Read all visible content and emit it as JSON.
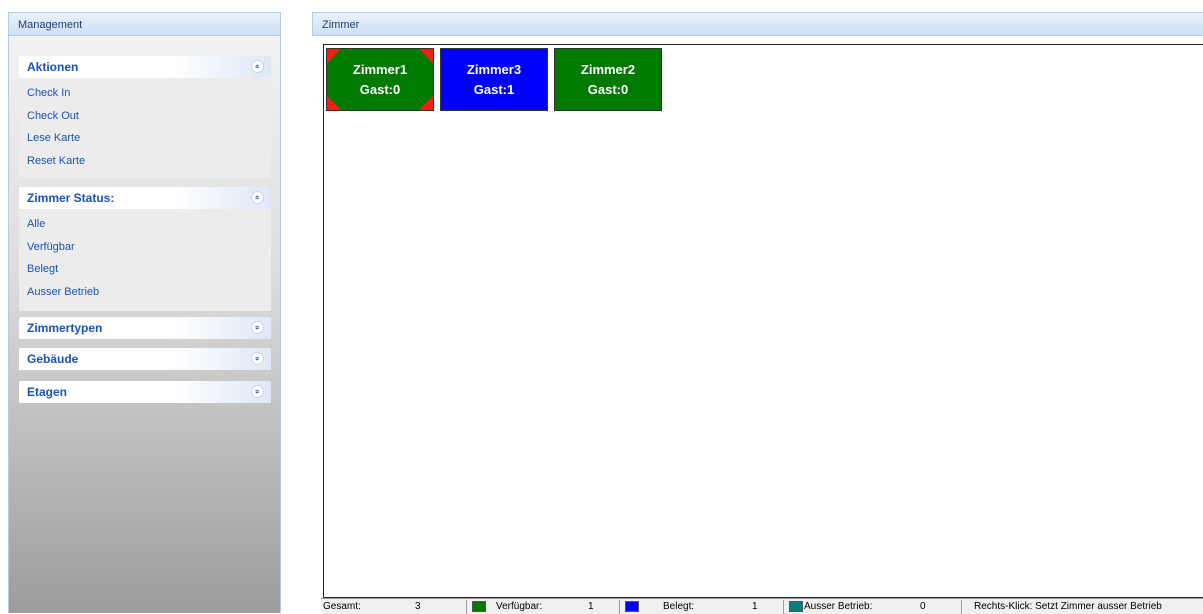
{
  "management": {
    "title": "Management"
  },
  "zimmer_panel": {
    "title": "Zimmer"
  },
  "sidebar": {
    "groups": [
      {
        "title": "Aktionen",
        "expanded": true,
        "items": [
          "Check In",
          "Check Out",
          "Lese Karte",
          "Reset Karte"
        ]
      },
      {
        "title": "Zimmer Status:",
        "expanded": true,
        "items": [
          "Alle",
          "Verfügbar",
          "Belegt",
          "Ausser Betrieb"
        ]
      },
      {
        "title": "Zimmertypen",
        "expanded": false
      },
      {
        "title": "Gebäude",
        "expanded": false
      },
      {
        "title": "Etagen",
        "expanded": false
      }
    ],
    "collapse_icon": "«",
    "expand_icon": "»"
  },
  "rooms": [
    {
      "name": "Zimmer1",
      "guests": "Gast:0",
      "color": "#007a00",
      "corner_color": "#ff1a1a"
    },
    {
      "name": "Zimmer3",
      "guests": "Gast:1",
      "color": "#0000ff"
    },
    {
      "name": "Zimmer2",
      "guests": "Gast:0",
      "color": "#007a00"
    }
  ],
  "statusbar": {
    "total_label": "Gesamt:",
    "total_value": "3",
    "available_label": "Verfügbar:",
    "available_value": "1",
    "available_color": "#007a00",
    "occupied_label": "Belegt:",
    "occupied_value": "1",
    "occupied_color": "#0000ff",
    "outofservice_label": "Ausser Betrieb:",
    "outofservice_value": "0",
    "outofservice_color": "#008080",
    "hint": "Rechts-Klick: Setzt Zimmer ausser Betrieb"
  }
}
